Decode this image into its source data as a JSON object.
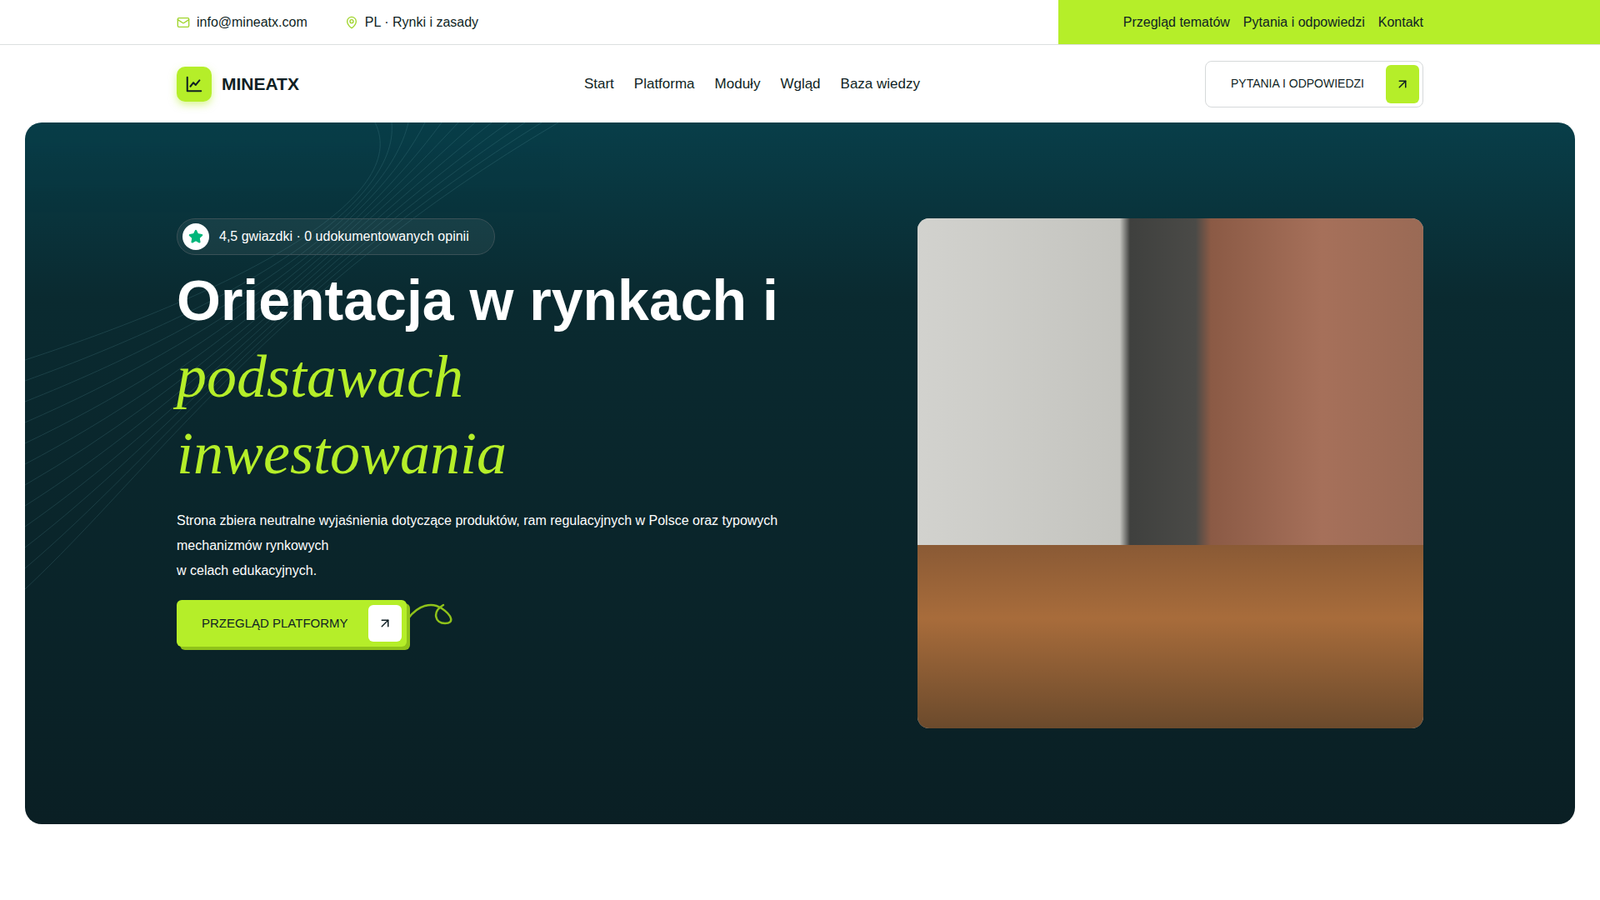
{
  "topbar": {
    "email": "info@mineatx.com",
    "location": "PL · Rynki i zasady",
    "links": [
      "Przegląd tematów",
      "Pytania i odpowiedzi",
      "Kontakt"
    ]
  },
  "logo": {
    "name": "MINEATX"
  },
  "nav": {
    "items": [
      {
        "label": "Start",
        "selected": false
      },
      {
        "label": "Platforma",
        "selected": false
      },
      {
        "label": "Moduły",
        "selected": false
      },
      {
        "label": "Wgląd",
        "selected": false
      },
      {
        "label": "Baza wiedzy",
        "selected": false
      }
    ],
    "button": "PYTANIA I ODPOWIEDZI"
  },
  "hero": {
    "badge": "4,5 gwiazdki · 0 udokumentowanych opinii",
    "title": "Orientacja w rynkach i",
    "title_highlight": [
      "podstawach",
      "inwestowania"
    ],
    "description": [
      "Strona zbiera neutralne wyjaśnienia dotyczące produktów, ram regulacyjnych w Polsce oraz typowych mechanizmów rynkowych",
      "w celach edukacyjnych."
    ],
    "cta": "PRZEGLĄD PLATFORMY"
  }
}
